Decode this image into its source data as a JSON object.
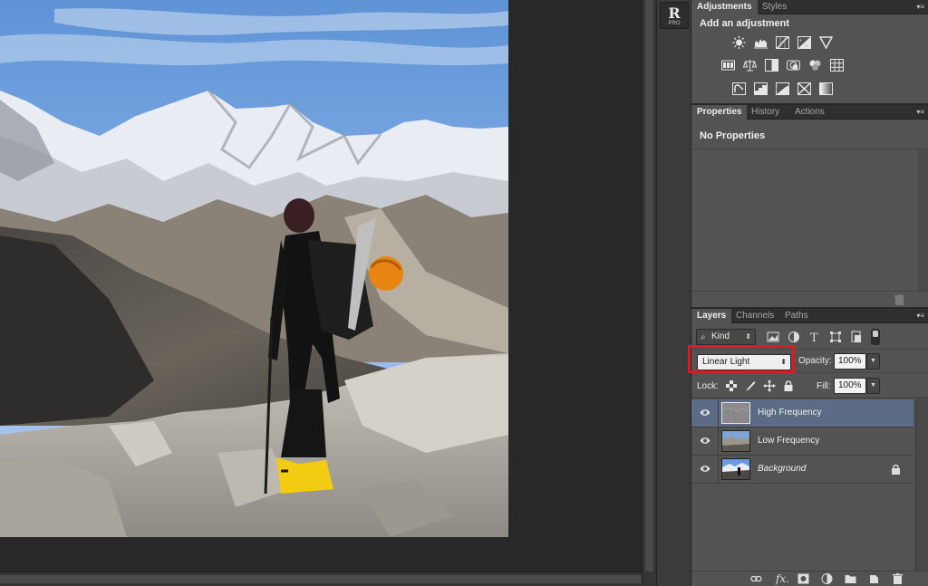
{
  "dock": {
    "plugin_letter": "R",
    "plugin_sub": "PRO"
  },
  "adjustments_panel": {
    "tabs": [
      {
        "label": "Adjustments",
        "active": true
      },
      {
        "label": "Styles",
        "active": false
      }
    ],
    "title": "Add an adjustment",
    "icon_rows": [
      [
        "brightness-contrast-icon",
        "levels-icon",
        "curves-icon",
        "exposure-icon",
        "vibrance-icon"
      ],
      [
        "hue-saturation-icon",
        "color-balance-icon",
        "black-white-icon",
        "photo-filter-icon",
        "channel-mixer-icon",
        "color-lookup-icon"
      ],
      [
        "invert-icon",
        "posterize-icon",
        "threshold-icon",
        "selective-color-icon",
        "gradient-map-icon"
      ]
    ]
  },
  "properties_panel": {
    "tabs": [
      {
        "label": "Properties",
        "active": true
      },
      {
        "label": "History",
        "active": false
      },
      {
        "label": "Actions",
        "active": false
      }
    ],
    "message": "No Properties"
  },
  "layers_panel": {
    "tabs": [
      {
        "label": "Layers",
        "active": true
      },
      {
        "label": "Channels",
        "active": false
      },
      {
        "label": "Paths",
        "active": false
      }
    ],
    "filter_kind": "Kind",
    "blend_mode": "Linear Light",
    "opacity_label": "Opacity:",
    "opacity_value": "100%",
    "lock_label": "Lock:",
    "fill_label": "Fill:",
    "fill_value": "100%",
    "layers": [
      {
        "name": "High Frequency",
        "selected": true,
        "visible": true,
        "locked": false
      },
      {
        "name": "Low Frequency",
        "selected": false,
        "visible": true,
        "locked": false
      },
      {
        "name": "Background",
        "selected": false,
        "visible": true,
        "locked": true
      }
    ]
  },
  "colors": {
    "panel_bg": "#535353",
    "selection_blue": "#5b6b85",
    "highlight_red": "#e0191f"
  }
}
